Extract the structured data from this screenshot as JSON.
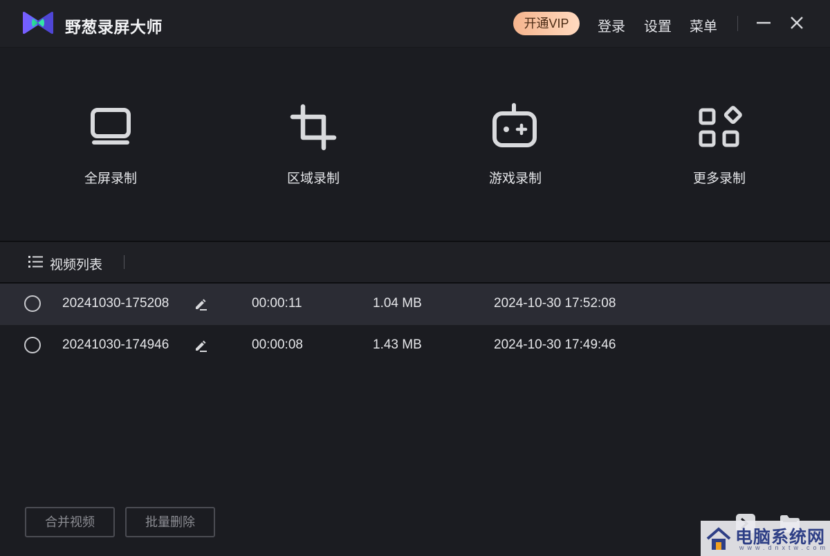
{
  "app": {
    "title": "野葱录屏大师",
    "vip_label": "开通VIP",
    "links": {
      "login": "登录",
      "settings": "设置",
      "menu": "菜单"
    },
    "window_controls": [
      "minimize-icon",
      "close-icon"
    ]
  },
  "modes": [
    {
      "label": "全屏录制",
      "icon": "monitor-icon"
    },
    {
      "label": "区域录制",
      "icon": "crop-icon"
    },
    {
      "label": "游戏录制",
      "icon": "gamepad-icon"
    },
    {
      "label": "更多录制",
      "icon": "apps-grid-icon"
    }
  ],
  "video_list": {
    "title": "视频列表",
    "rows": [
      {
        "name": "20241030-175208",
        "duration": "00:00:11",
        "size": "1.04 MB",
        "created": "2024-10-30 17:52:08",
        "selected": false,
        "highlighted": true
      },
      {
        "name": "20241030-174946",
        "duration": "00:00:08",
        "size": "1.43 MB",
        "created": "2024-10-30 17:49:46",
        "selected": false,
        "highlighted": false
      }
    ]
  },
  "bottom": {
    "merge_label": "合并视频",
    "batch_delete_label": "批量删除",
    "tools": [
      "export-icon",
      "folder-icon"
    ]
  },
  "watermark": {
    "text": "电脑系统网",
    "url": "www.dnxtw.com"
  },
  "colors": {
    "background": "#1b1c21",
    "titlebar": "#1f2025",
    "row_highlight": "#2b2c34",
    "vip_gradient_start": "#f6b58e",
    "vip_gradient_end": "#ffd9bf",
    "logo_purple": "#6c5cff",
    "logo_green": "#2fe0a0"
  }
}
